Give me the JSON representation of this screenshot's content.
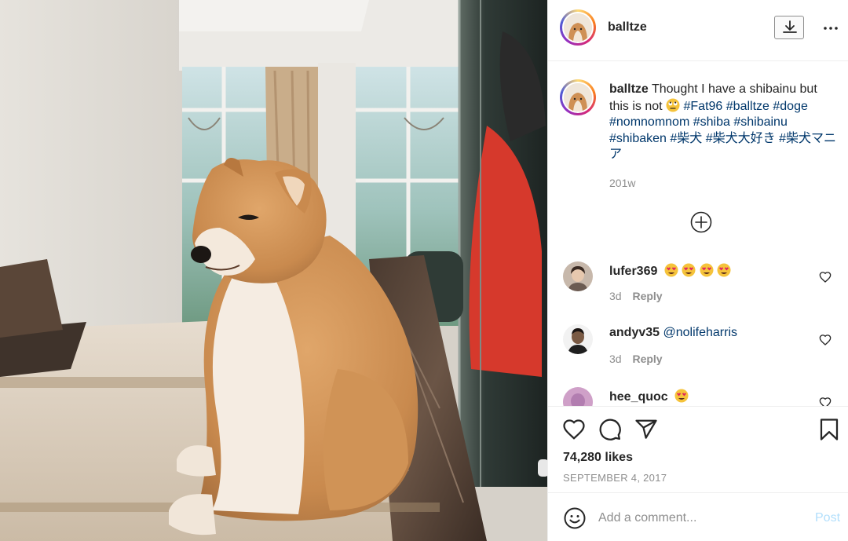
{
  "photo": {
    "alt": "Shiba inu sitting on a marble counter"
  },
  "header": {
    "username": "balltze",
    "download_icon": "download-icon",
    "more_icon": "more-options-icon"
  },
  "caption": {
    "username": "balltze",
    "text": "Thought I have a shibainu but this is not",
    "emoji": "rolling-eyes-emoji",
    "hashtags": [
      "#Fat96",
      "#balltze",
      "#doge",
      "#nomnomnom",
      "#shiba",
      "#shibainu",
      "#shibaken",
      "#柴犬",
      "#柴犬大好き",
      "#柴犬マニア"
    ],
    "time": "201w"
  },
  "load_more_icon": "plus-circle-icon",
  "comments": [
    {
      "username": "lufer369",
      "text": "",
      "emoji": "heart-eyes-emoji x4",
      "age": "3d",
      "reply": "Reply"
    },
    {
      "username": "andyv35",
      "text": "@nolifeharris",
      "emoji": "",
      "age": "3d",
      "reply": "Reply"
    },
    {
      "username": "hee_quoc",
      "text": "",
      "emoji": "heart-eyes-emoji",
      "age": "",
      "reply": ""
    }
  ],
  "actions": {
    "like_icon": "heart-icon",
    "comment_icon": "comment-icon",
    "share_icon": "share-icon",
    "save_icon": "bookmark-icon"
  },
  "likes": "74,280 likes",
  "date": "SEPTEMBER 4, 2017",
  "add_comment": {
    "placeholder": "Add a comment...",
    "post_label": "Post",
    "emoji_icon": "smiley-icon"
  },
  "colors": {
    "hashtag": "#00376b",
    "muted": "#8e8e8e",
    "border": "#efefef",
    "post_disabled": "#b2dffc",
    "heart_eyes": "#f5c33b"
  }
}
